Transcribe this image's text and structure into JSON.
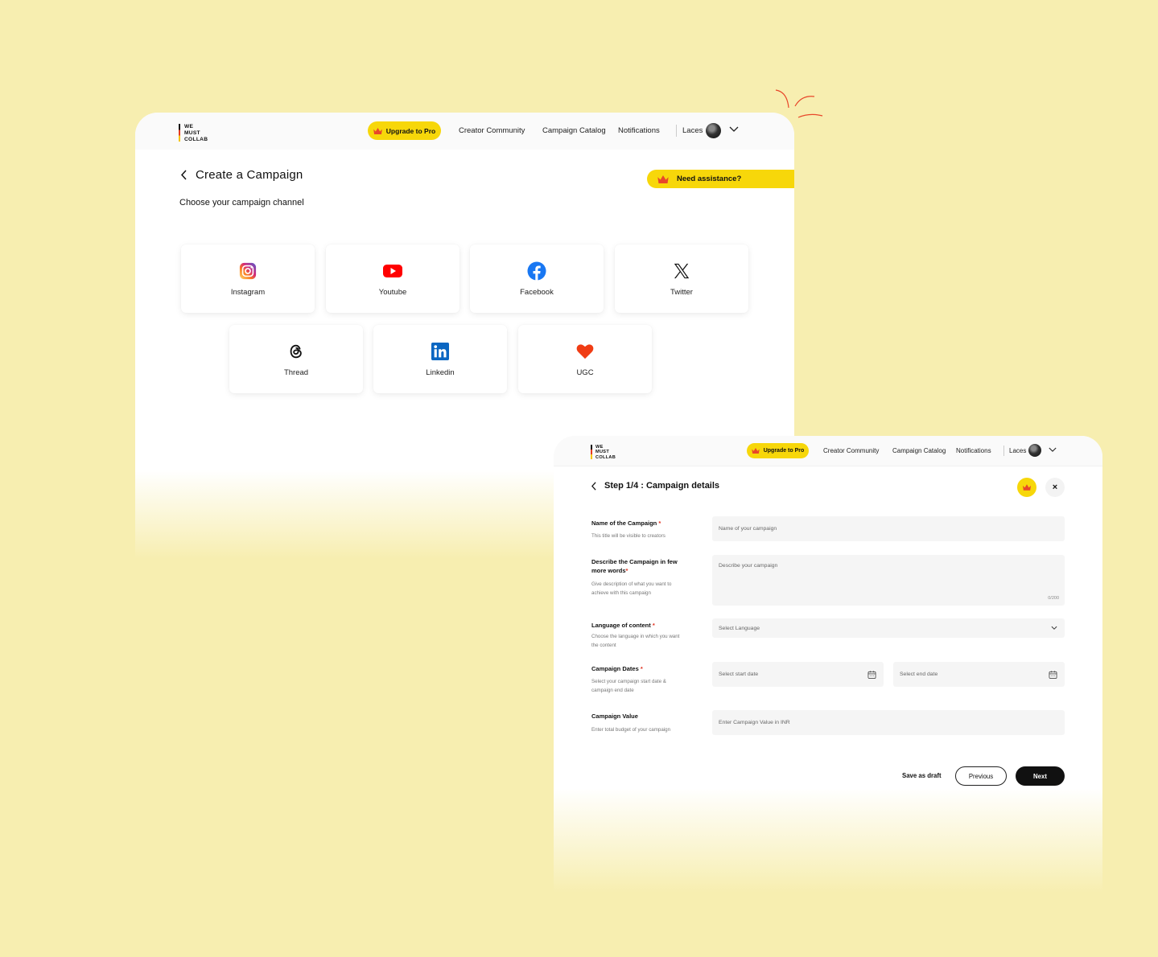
{
  "colors": {
    "background": "#f7eeb0",
    "accent": "#f7d70a",
    "required": "#e0301e"
  },
  "brand": {
    "line1": "WE",
    "line2": "MUST",
    "line3": "COLLAB"
  },
  "nav": {
    "upgrade_label": "Upgrade to Pro",
    "creator_community": "Creator Community",
    "campaign_catalog": "Campaign Catalog",
    "notifications": "Notifications",
    "user_name": "Laces"
  },
  "create": {
    "title": "Create a Campaign",
    "subtitle": "Choose your campaign channel",
    "assist_label": "Need assistance?",
    "channels": [
      {
        "label": "Instagram",
        "icon": "instagram-icon"
      },
      {
        "label": "Youtube",
        "icon": "youtube-icon"
      },
      {
        "label": "Facebook",
        "icon": "facebook-icon"
      },
      {
        "label": "Twitter",
        "icon": "x-twitter-icon"
      },
      {
        "label": "Thread",
        "icon": "threads-icon"
      },
      {
        "label": "Linkedin",
        "icon": "linkedin-icon"
      },
      {
        "label": "UGC",
        "icon": "heart-icon"
      }
    ]
  },
  "details": {
    "title": "Step 1/4 : Campaign details",
    "close_label": "×",
    "fields": {
      "name": {
        "label": "Name of the Campaign",
        "req": "*",
        "hint": "This title will be visible to creators",
        "placeholder": "Name of your campaign"
      },
      "describe": {
        "label": "Describe the Campaign in few more words",
        "req": "*",
        "hint": "Give description of what you want to achieve with this campaign",
        "placeholder": "Describe your campaign",
        "counter": "0/200"
      },
      "language": {
        "label": "Language of content",
        "req": "*",
        "hint": "Choose the language in which you want the content",
        "placeholder": "Select Language"
      },
      "dates": {
        "label": "Campaign Dates",
        "req": "*",
        "hint": "Select your campaign start date & campaign end date",
        "start_placeholder": "Select start date",
        "end_placeholder": "Select end date"
      },
      "value": {
        "label": "Campaign Value",
        "hint": "Enter total budget of your campaign",
        "placeholder": "Enter Campaign Value in INR"
      }
    },
    "buttons": {
      "draft": "Save as draft",
      "previous": "Previous",
      "next": "Next"
    }
  }
}
